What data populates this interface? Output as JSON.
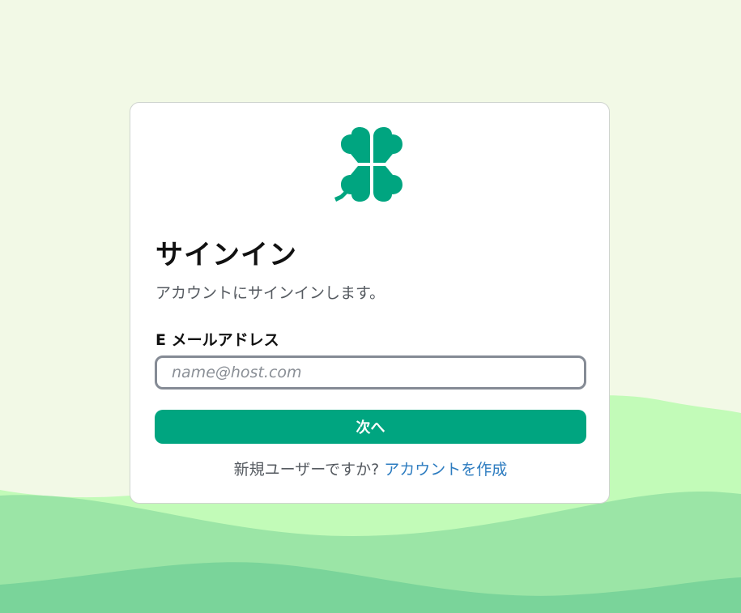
{
  "signin": {
    "title": "サインイン",
    "subtitle": "アカウントにサインインします。",
    "email_label": "E メールアドレス",
    "email_placeholder": "name@host.com",
    "email_value": "",
    "next_button_label": "次へ",
    "new_user_prompt": "新規ユーザーですか?",
    "create_account_link": "アカウントを作成"
  },
  "icons": {
    "logo": "four-leaf-clover-icon"
  },
  "colors": {
    "brand": "#00a580",
    "link": "#2d7cc0",
    "background": "#f2f9e6",
    "wave_light": "#c2fbb8",
    "wave_mid": "#9be5a6",
    "wave_dark": "#7ad49a"
  }
}
